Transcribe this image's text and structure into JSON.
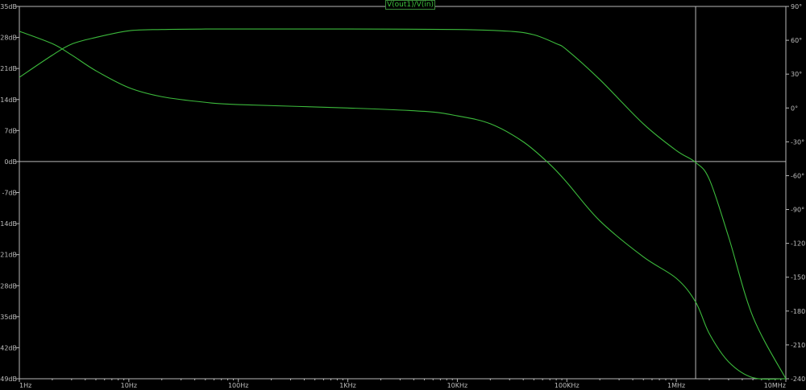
{
  "legend": {
    "label": "V(out1)/V(in)"
  },
  "colors": {
    "background": "#000000",
    "grid": "#b8b8b8",
    "trace": "#3cba3c",
    "text": "#bdbdbd"
  },
  "chart_data": {
    "type": "line",
    "x_scale": "log",
    "xlim_hz": [
      1,
      10000000
    ],
    "x_tick_labels": [
      "1Hz",
      "10Hz",
      "100Hz",
      "1KHz",
      "10KHz",
      "100KHz",
      "1MHz",
      "10MHz"
    ],
    "ylim_left_db": [
      -49,
      35
    ],
    "y_left_tick_labels": [
      "35dB",
      "28dB",
      "21dB",
      "14dB",
      "7dB",
      "0dB",
      "-7dB",
      "-14dB",
      "-21dB",
      "-28dB",
      "-35dB",
      "-42dB",
      "-49dB"
    ],
    "ylim_right_deg": [
      -240,
      90
    ],
    "y_right_tick_labels": [
      "90°",
      "60°",
      "30°",
      "0°",
      "-30°",
      "-60°",
      "-90°",
      "-120°",
      "-150°",
      "-180°",
      "-210°",
      "-240°"
    ],
    "cursor_hz": 1500000,
    "series": [
      {
        "name": "V(out1)/V(in)",
        "axis": "left",
        "unit": "dB",
        "x": [
          1,
          2,
          3,
          5,
          10,
          20,
          50,
          100,
          1000,
          10000,
          30000,
          50000,
          80000,
          100000,
          200000,
          500000,
          1000000,
          1500000,
          2000000,
          3000000,
          5000000,
          10000000
        ],
        "y": [
          19,
          24,
          26.5,
          28,
          29.5,
          29.8,
          29.9,
          29.9,
          29.9,
          29.8,
          29.4,
          28.6,
          26.6,
          25.2,
          18.5,
          8.5,
          2.5,
          -0.2,
          -4,
          -17,
          -35,
          -49
        ]
      },
      {
        "name": "phase",
        "axis": "right",
        "unit": "deg",
        "x": [
          1,
          2,
          3,
          5,
          10,
          20,
          50,
          100,
          1000,
          5000,
          10000,
          20000,
          40000,
          70000,
          100000,
          200000,
          500000,
          1000000,
          1500000,
          2000000,
          3000000,
          5000000,
          10000000
        ],
        "y": [
          68,
          57,
          47,
          33,
          18,
          10,
          5,
          3,
          0,
          -3,
          -7,
          -14,
          -30,
          -50,
          -66,
          -100,
          -132,
          -151,
          -172,
          -200,
          -225,
          -239,
          -240
        ]
      }
    ]
  }
}
